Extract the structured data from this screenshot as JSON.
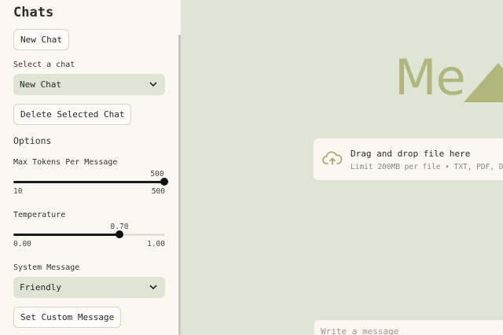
{
  "sidebar": {
    "title": "Chats",
    "new_chat_label": "New Chat",
    "select_chat_label": "Select a chat",
    "selected_chat": "New Chat",
    "delete_label": "Delete Selected Chat",
    "options_label": "Options",
    "max_tokens": {
      "label": "Max Tokens Per Message",
      "value": "500",
      "min": "10",
      "max": "500",
      "fraction": 1.0
    },
    "temperature": {
      "label": "Temperature",
      "value": "0.70",
      "min": "0.00",
      "max": "1.00",
      "fraction": 0.7
    },
    "system_message_label": "System Message",
    "system_message_value": "Friendly",
    "custom_message_label": "Set Custom Message"
  },
  "main": {
    "logo_text": "Me",
    "uploader": {
      "title": "Drag and drop file here",
      "subtitle": "Limit 200MB per file • TXT, PDF, D"
    },
    "chat_input_placeholder": "Write a message"
  },
  "colors": {
    "accent": "#b1b67f",
    "sidebar_bg": "#fcf7f0",
    "main_bg": "#dfe5d4"
  },
  "icons": [
    "chevron-down-icon",
    "cloud-upload-icon",
    "logo-triangle-icon"
  ]
}
